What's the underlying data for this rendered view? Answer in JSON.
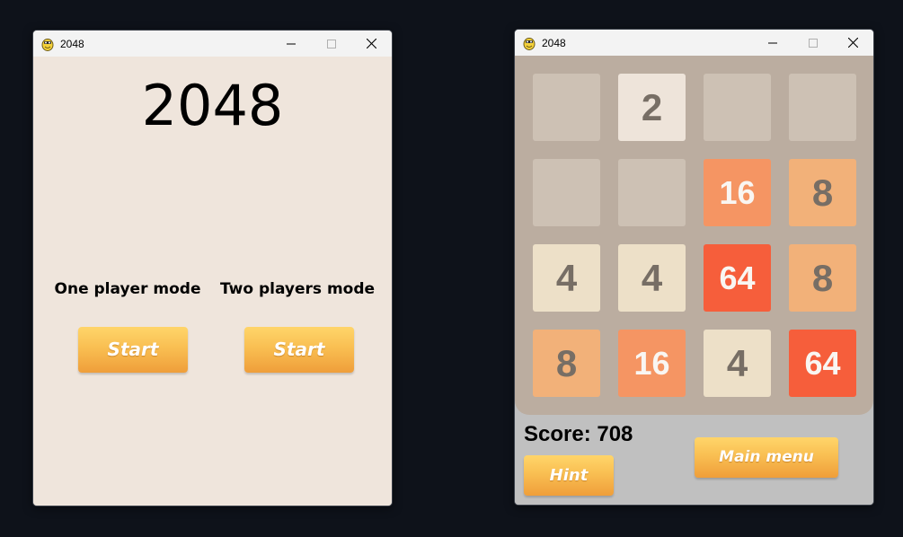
{
  "menu_window": {
    "title": "2048",
    "heading": "2048",
    "modes": [
      {
        "label": "One player mode",
        "button_label": "Start"
      },
      {
        "label": "Two players mode",
        "button_label": "Start"
      }
    ]
  },
  "game_window": {
    "title": "2048",
    "board": [
      [
        "",
        "2",
        "",
        ""
      ],
      [
        "",
        "",
        "16",
        "8"
      ],
      [
        "4",
        "4",
        "64",
        "8"
      ],
      [
        "8",
        "16",
        "4",
        "64"
      ]
    ],
    "score_text": "Score: 708",
    "hint_label": "Hint",
    "main_menu_label": "Main menu"
  },
  "tile_colors": {
    "empty": "#cdc1b4",
    "2": "#eee4da",
    "4": "#ede0c8",
    "8": "#f2b179",
    "16": "#f59563",
    "64": "#f65e3b"
  },
  "icons": [
    "pygame-snake-icon",
    "minimize-icon",
    "maximize-icon",
    "close-icon"
  ]
}
